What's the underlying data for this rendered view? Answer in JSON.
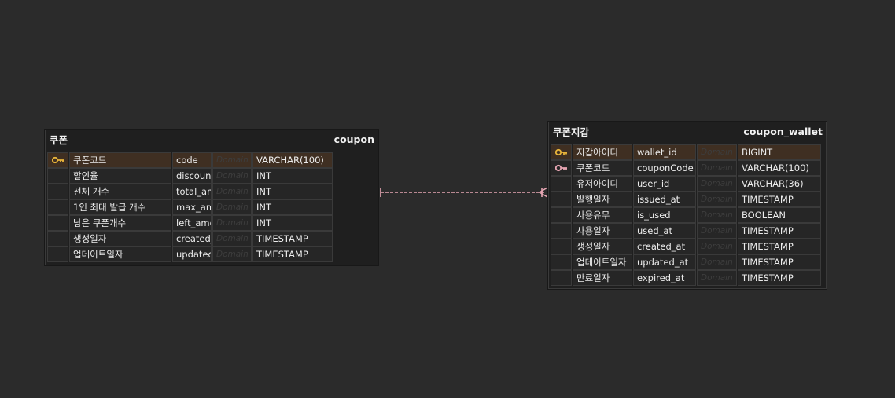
{
  "tables": {
    "coupon": {
      "logical_name": "쿠폰",
      "physical_name": "coupon",
      "columns": [
        {
          "key": "pk",
          "logical": "쿠폰코드",
          "physical": "code",
          "domain": "Domain",
          "type": "VARCHAR(100)"
        },
        {
          "key": "",
          "logical": "할인율",
          "physical": "discount",
          "domain": "Domain",
          "type": "INT"
        },
        {
          "key": "",
          "logical": "전체 개수",
          "physical": "total_amount",
          "domain": "Domain",
          "type": "INT"
        },
        {
          "key": "",
          "logical": "1인 최대 발급 개수",
          "physical": "max_amount_per_user",
          "domain": "Domain",
          "type": "INT"
        },
        {
          "key": "",
          "logical": "남은 쿠폰개수",
          "physical": "left_amount",
          "domain": "Domain",
          "type": "INT"
        },
        {
          "key": "",
          "logical": "생성일자",
          "physical": "created_at",
          "domain": "Domain",
          "type": "TIMESTAMP"
        },
        {
          "key": "",
          "logical": "업데이트일자",
          "physical": "updated_at",
          "domain": "Domain",
          "type": "TIMESTAMP"
        }
      ]
    },
    "coupon_wallet": {
      "logical_name": "쿠폰지갑",
      "physical_name": "coupon_wallet",
      "columns": [
        {
          "key": "pk",
          "logical": "지갑아이디",
          "physical": "wallet_id",
          "domain": "Domain",
          "type": "BIGINT"
        },
        {
          "key": "fk",
          "logical": "쿠폰코드",
          "physical": "couponCode",
          "domain": "Domain",
          "type": "VARCHAR(100)"
        },
        {
          "key": "",
          "logical": "유저아이디",
          "physical": "user_id",
          "domain": "Domain",
          "type": "VARCHAR(36)"
        },
        {
          "key": "",
          "logical": "발행일자",
          "physical": "issued_at",
          "domain": "Domain",
          "type": "TIMESTAMP"
        },
        {
          "key": "",
          "logical": "사용유무",
          "physical": "is_used",
          "domain": "Domain",
          "type": "BOOLEAN"
        },
        {
          "key": "",
          "logical": "사용일자",
          "physical": "used_at",
          "domain": "Domain",
          "type": "TIMESTAMP"
        },
        {
          "key": "",
          "logical": "생성일자",
          "physical": "created_at",
          "domain": "Domain",
          "type": "TIMESTAMP"
        },
        {
          "key": "",
          "logical": "업데이트일자",
          "physical": "updated_at",
          "domain": "Domain",
          "type": "TIMESTAMP"
        },
        {
          "key": "",
          "logical": "만료일자",
          "physical": "expired_at",
          "domain": "Domain",
          "type": "TIMESTAMP"
        }
      ]
    }
  },
  "relationship": {
    "from": "coupon",
    "to": "coupon_wallet",
    "from_cardinality": "one",
    "to_cardinality": "zero-or-many",
    "style": "dashed"
  },
  "colors": {
    "background": "#2b2b2b",
    "table_bg": "#1f1f1f",
    "pk_row": "#3f2f22",
    "pk_icon": "#e8b43a",
    "fk_icon": "#e8a7b4",
    "relation_line": "#e8a7b4"
  },
  "icons": {
    "pk": "key-icon",
    "fk": "key-icon"
  }
}
